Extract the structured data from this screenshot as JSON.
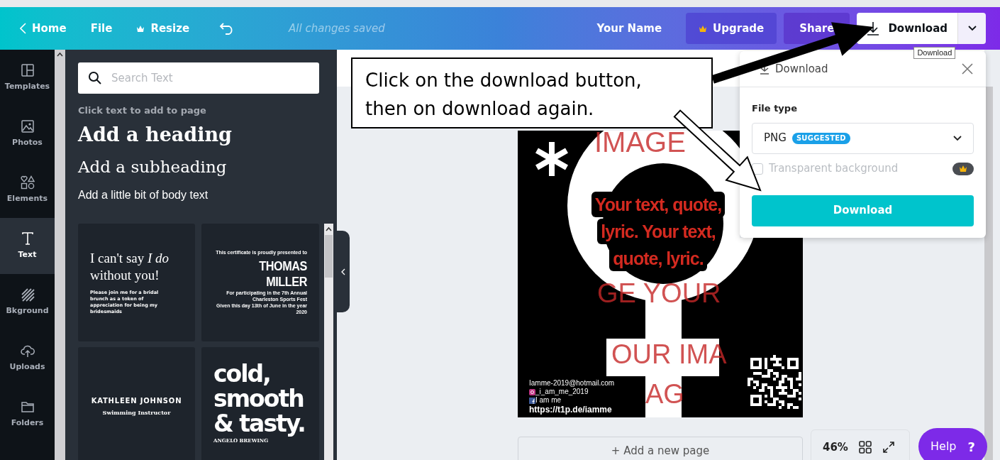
{
  "topbar": {
    "nav": [
      {
        "kind": "back",
        "label": "Home"
      },
      {
        "kind": "plain",
        "label": "File"
      },
      {
        "kind": "premium",
        "label": "Resize"
      },
      {
        "kind": "undo"
      }
    ],
    "save_status": "All changes saved",
    "user_name": "Your Name",
    "upgrade": "Upgrade",
    "share": "Share",
    "download": "Download",
    "tooltip": "Download"
  },
  "rail": [
    {
      "label": "Templates",
      "selected": false
    },
    {
      "label": "Photos",
      "selected": false
    },
    {
      "label": "Elements",
      "selected": false
    },
    {
      "label": "Text",
      "selected": true
    },
    {
      "label": "Bkground",
      "selected": false
    },
    {
      "label": "Uploads",
      "selected": false
    },
    {
      "label": "Folders",
      "selected": false
    }
  ],
  "text_panel": {
    "search_placeholder": "Search Text",
    "hint": "Click text to add to page",
    "heading": "Add a heading",
    "subheading": "Add a subheading",
    "body": "Add a little bit of body text",
    "cards": [
      {
        "kind": "bridal",
        "title": "I can't say *I do* without you!",
        "note": "Please join me for a bridal brunch as a token of appreciation for being my bridesmaids"
      },
      {
        "kind": "certificate",
        "intro": "This certificate is proudly presented to",
        "name": "THOMAS MILLER",
        "lines": [
          "For participating in the 7th Annual Charleston Sports Fest",
          "Given this day 13th of June in the year 2020"
        ]
      },
      {
        "kind": "name",
        "name": "KATHLEEN JOHNSON",
        "role": "Swimming Instructor"
      },
      {
        "kind": "slogan",
        "lines": [
          "cold,",
          "smooth",
          "& tasty."
        ],
        "footer": "ANGELO BREWING"
      }
    ]
  },
  "callout": "Click on the download button, then on download again.",
  "design": {
    "background_words": [
      "IMAGE",
      "GE YOUR",
      "OUR IMA",
      "AG"
    ],
    "quote_lines": [
      "Your text, quote,",
      "lyric. Your text,",
      "quote, lyric."
    ],
    "contacts": [
      {
        "kind": "plain",
        "text": "Iamme-2019@hotmail.com"
      },
      {
        "kind": "instagram",
        "text": "_i_am_me_2019"
      },
      {
        "kind": "facebook",
        "text": "I am me"
      },
      {
        "kind": "link",
        "text": "https://t1p.de/iamme"
      }
    ]
  },
  "download_panel": {
    "title": "Download",
    "file_type_label": "File type",
    "format": "PNG",
    "badge": "SUGGESTED",
    "transparent": {
      "label": "Transparent background",
      "checked": false
    },
    "button": "Download"
  },
  "add_page": "+ Add a new page",
  "zoom": "46%",
  "help": {
    "label": "Help",
    "icon": "?"
  }
}
